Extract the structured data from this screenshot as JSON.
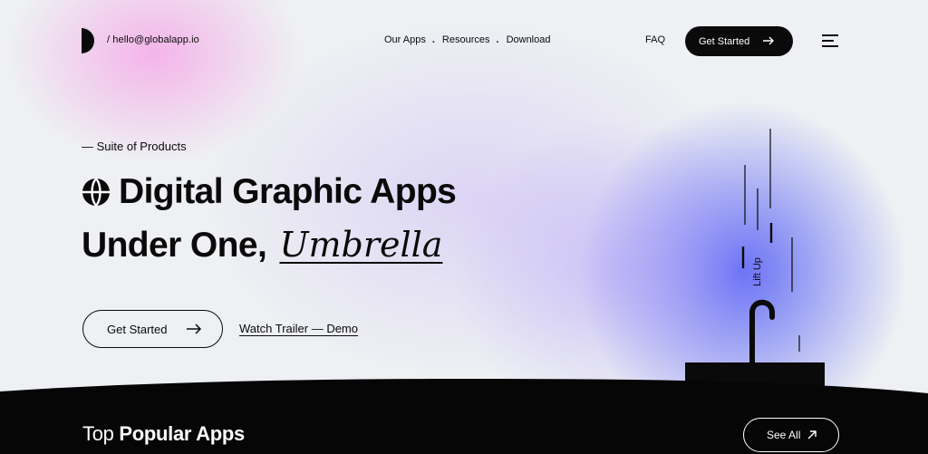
{
  "header": {
    "email": "/ hello@globalapp.io",
    "nav": [
      {
        "label": "Our Apps"
      },
      {
        "label": "Resources"
      },
      {
        "label": "Download"
      }
    ],
    "nav_separator": ".",
    "faq": "FAQ",
    "cta": "Get Started"
  },
  "hero": {
    "eyebrow": "— Suite of Products",
    "title_line1": "Digital Graphic Apps",
    "title_line2_prefix": "Under One,",
    "title_line2_emph": "Umbrella",
    "primary_button": "Get Started",
    "secondary_link": "Watch Trailer — Demo",
    "art_label": "Lift Up"
  },
  "popular": {
    "title_light": "Top",
    "title_bold": "Popular Apps",
    "see_all": "See All"
  },
  "colors": {
    "ink": "#0a0a0a",
    "pink_glow": "#f6a0e6",
    "blue_glow": "#5f69f5",
    "background": "#eef0f3"
  }
}
